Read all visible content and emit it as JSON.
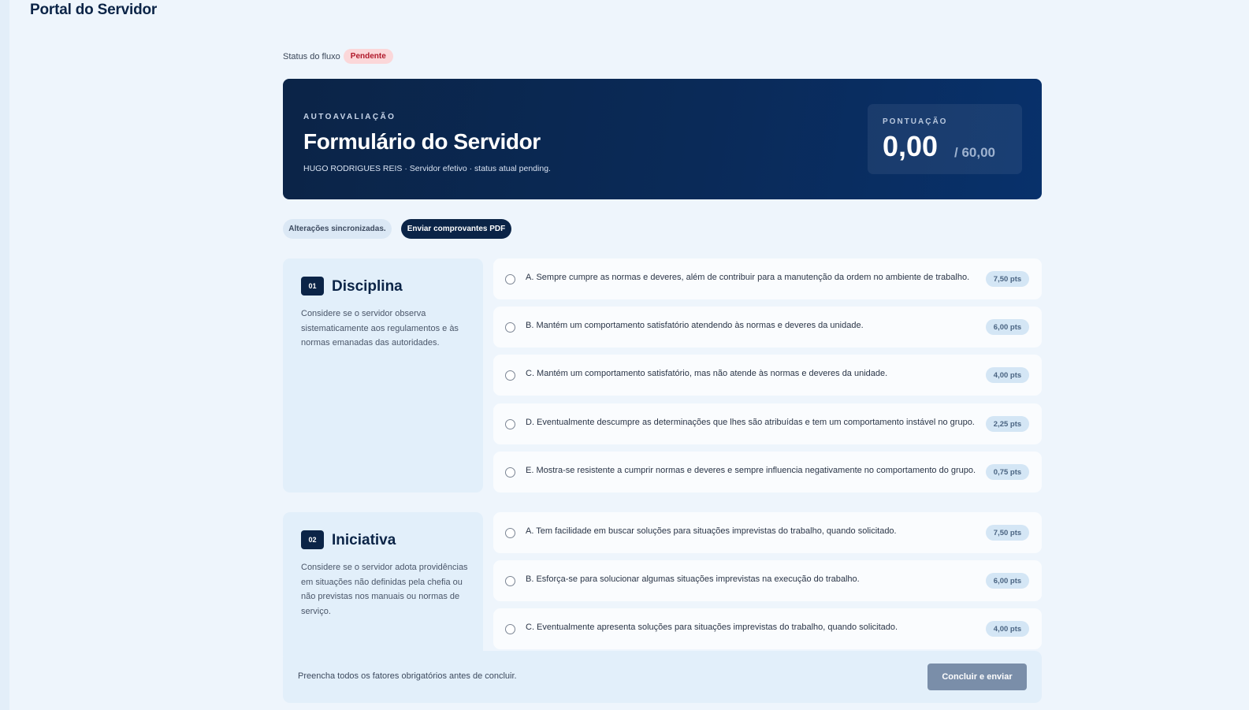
{
  "header": {
    "title": "Portal do Servidor"
  },
  "status": {
    "label": "Status do fluxo",
    "badge": "Pendente"
  },
  "hero": {
    "eyebrow": "AUTOAVALIAÇÃO",
    "title": "Formulário do Servidor",
    "subtitle": "HUGO RODRIGUES REIS · Servidor efetivo · status atual pending.",
    "score_label": "PONTUAÇÃO",
    "score_value": "0,00",
    "score_max": "/ 60,00"
  },
  "actions": {
    "sync_status": "Alterações sincronizadas.",
    "upload_button": "Enviar comprovantes PDF"
  },
  "factors": [
    {
      "number": "01",
      "name": "Disciplina",
      "description": "Considere se o servidor observa sistematicamente aos regulamentos e às normas emanadas das autoridades.",
      "options": [
        {
          "text": "A. Sempre cumpre as normas e deveres, além de contribuir para a manutenção da ordem no ambiente de trabalho.",
          "points": "7,50 pts"
        },
        {
          "text": "B. Mantém um comportamento satisfatório atendendo às normas e deveres da unidade.",
          "points": "6,00 pts"
        },
        {
          "text": "C. Mantém um comportamento satisfatório, mas não atende às normas e deveres da unidade.",
          "points": "4,00 pts"
        },
        {
          "text": "D. Eventualmente descumpre as determinações que lhes são atribuídas e tem um comportamento instável no grupo.",
          "points": "2,25 pts"
        },
        {
          "text": "E. Mostra-se resistente a cumprir normas e deveres e sempre influencia negativamente no comportamento do grupo.",
          "points": "0,75 pts"
        }
      ]
    },
    {
      "number": "02",
      "name": "Iniciativa",
      "description": "Considere se o servidor adota providências em situações não definidas pela chefia ou não previstas nos manuais ou normas de serviço.",
      "options": [
        {
          "text": "A. Tem facilidade em buscar soluções para situações imprevistas do trabalho, quando solicitado.",
          "points": "7,50 pts"
        },
        {
          "text": "B. Esforça-se para solucionar algumas situações imprevistas na execução do trabalho.",
          "points": "6,00 pts"
        },
        {
          "text": "C. Eventualmente apresenta soluções para situações imprevistas do trabalho, quando solicitado.",
          "points": "4,00 pts"
        }
      ]
    }
  ],
  "footer": {
    "hint": "Preencha todos os fatores obrigatórios antes de concluir.",
    "submit_button": "Concluir e enviar"
  }
}
